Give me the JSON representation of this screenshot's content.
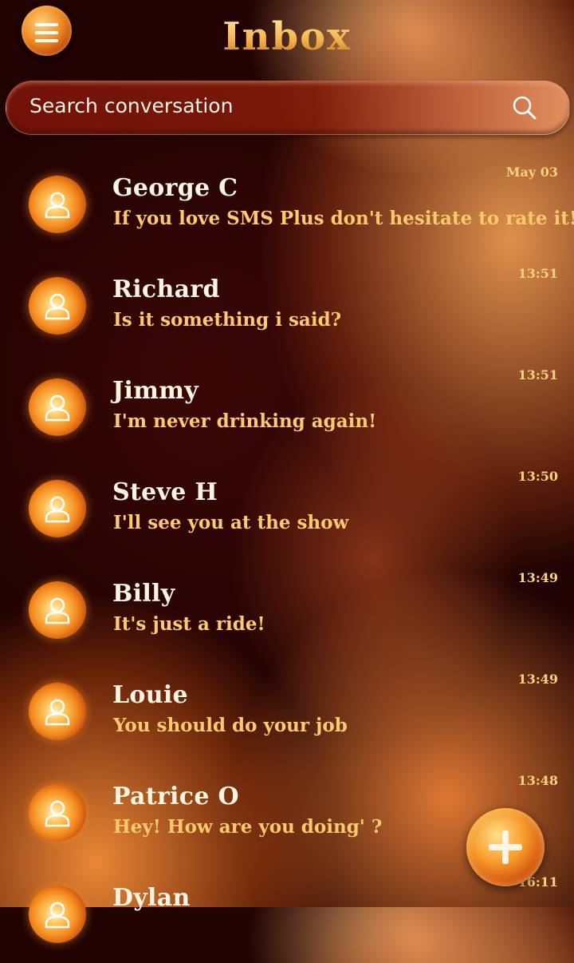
{
  "header": {
    "title": "Inbox",
    "menu_icon": "hamburger-menu-icon"
  },
  "search": {
    "placeholder": "Search conversation",
    "icon": "search-icon"
  },
  "conversations": [
    {
      "name": "George C",
      "preview": "If you love SMS Plus don't hesitate to rate it!",
      "time": "May 03"
    },
    {
      "name": "Richard",
      "preview": "Is it something i said?",
      "time": "13:51"
    },
    {
      "name": "Jimmy",
      "preview": "I'm never drinking again!",
      "time": "13:51"
    },
    {
      "name": "Steve H",
      "preview": "I'll see you at the show",
      "time": "13:50"
    },
    {
      "name": "Billy",
      "preview": "It's just a ride!",
      "time": "13:49"
    },
    {
      "name": "Louie",
      "preview": "You should do your job",
      "time": "13:49"
    },
    {
      "name": "Patrice O",
      "preview": "Hey! How are you doing' ?",
      "time": "13:48"
    },
    {
      "name": "Dylan",
      "preview": "",
      "time": "16:11"
    }
  ],
  "fab": {
    "icon": "plus-icon"
  },
  "colors": {
    "accent": "#f6a43a",
    "name_text": "#fff5e2",
    "preview_text": "#ffc96c",
    "background": "#2a0504"
  }
}
